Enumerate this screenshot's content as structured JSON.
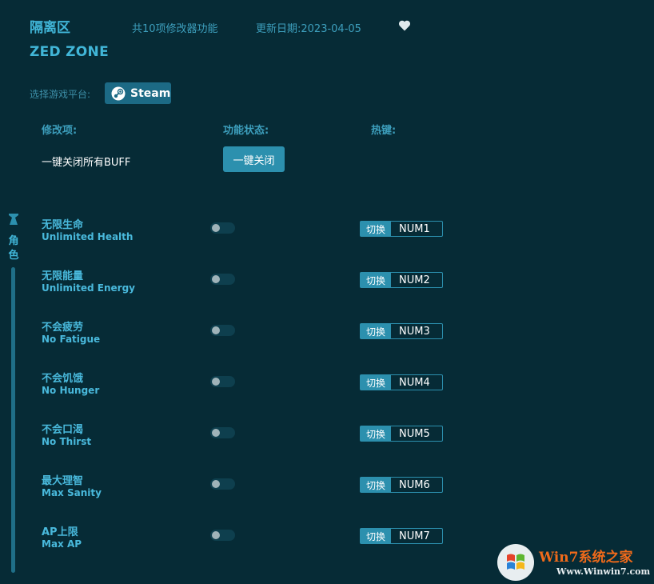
{
  "header": {
    "title_cn": "隔离区",
    "title_en": "ZED ZONE",
    "feature_count": "共10项修改器功能",
    "update_date": "更新日期:2023-04-05",
    "favorite_icon": "heart-icon"
  },
  "platform": {
    "label": "选择游戏平台:",
    "steam_label": "Steam",
    "steam_icon": "steam-icon"
  },
  "columns": {
    "item": "修改项:",
    "status": "功能状态:",
    "hotkey": "热键:"
  },
  "buff": {
    "label": "一键关闭所有BUFF",
    "button": "一键关闭"
  },
  "sidebar": {
    "icon": "character-icon",
    "label": "角色"
  },
  "cheats": [
    {
      "cn": "无限生命",
      "en": "Unlimited Health",
      "switch": "切换",
      "key": "NUM1",
      "enabled": false
    },
    {
      "cn": "无限能量",
      "en": "Unlimited Energy",
      "switch": "切换",
      "key": "NUM2",
      "enabled": false
    },
    {
      "cn": "不会疲劳",
      "en": "No Fatigue",
      "switch": "切换",
      "key": "NUM3",
      "enabled": false
    },
    {
      "cn": "不会饥饿",
      "en": "No Hunger",
      "switch": "切换",
      "key": "NUM4",
      "enabled": false
    },
    {
      "cn": "不会口渴",
      "en": "No Thirst",
      "switch": "切换",
      "key": "NUM5",
      "enabled": false
    },
    {
      "cn": "最大理智",
      "en": "Max Sanity",
      "switch": "切换",
      "key": "NUM6",
      "enabled": false
    },
    {
      "cn": "AP上限",
      "en": "Max AP",
      "switch": "切换",
      "key": "NUM7",
      "enabled": false
    }
  ],
  "watermark": {
    "title": "Win7系统之家",
    "url": "Www.Winwin7.com"
  },
  "colors": {
    "background": "#062b36",
    "accent": "#2c90ae",
    "text_accent": "#41b6d8"
  }
}
